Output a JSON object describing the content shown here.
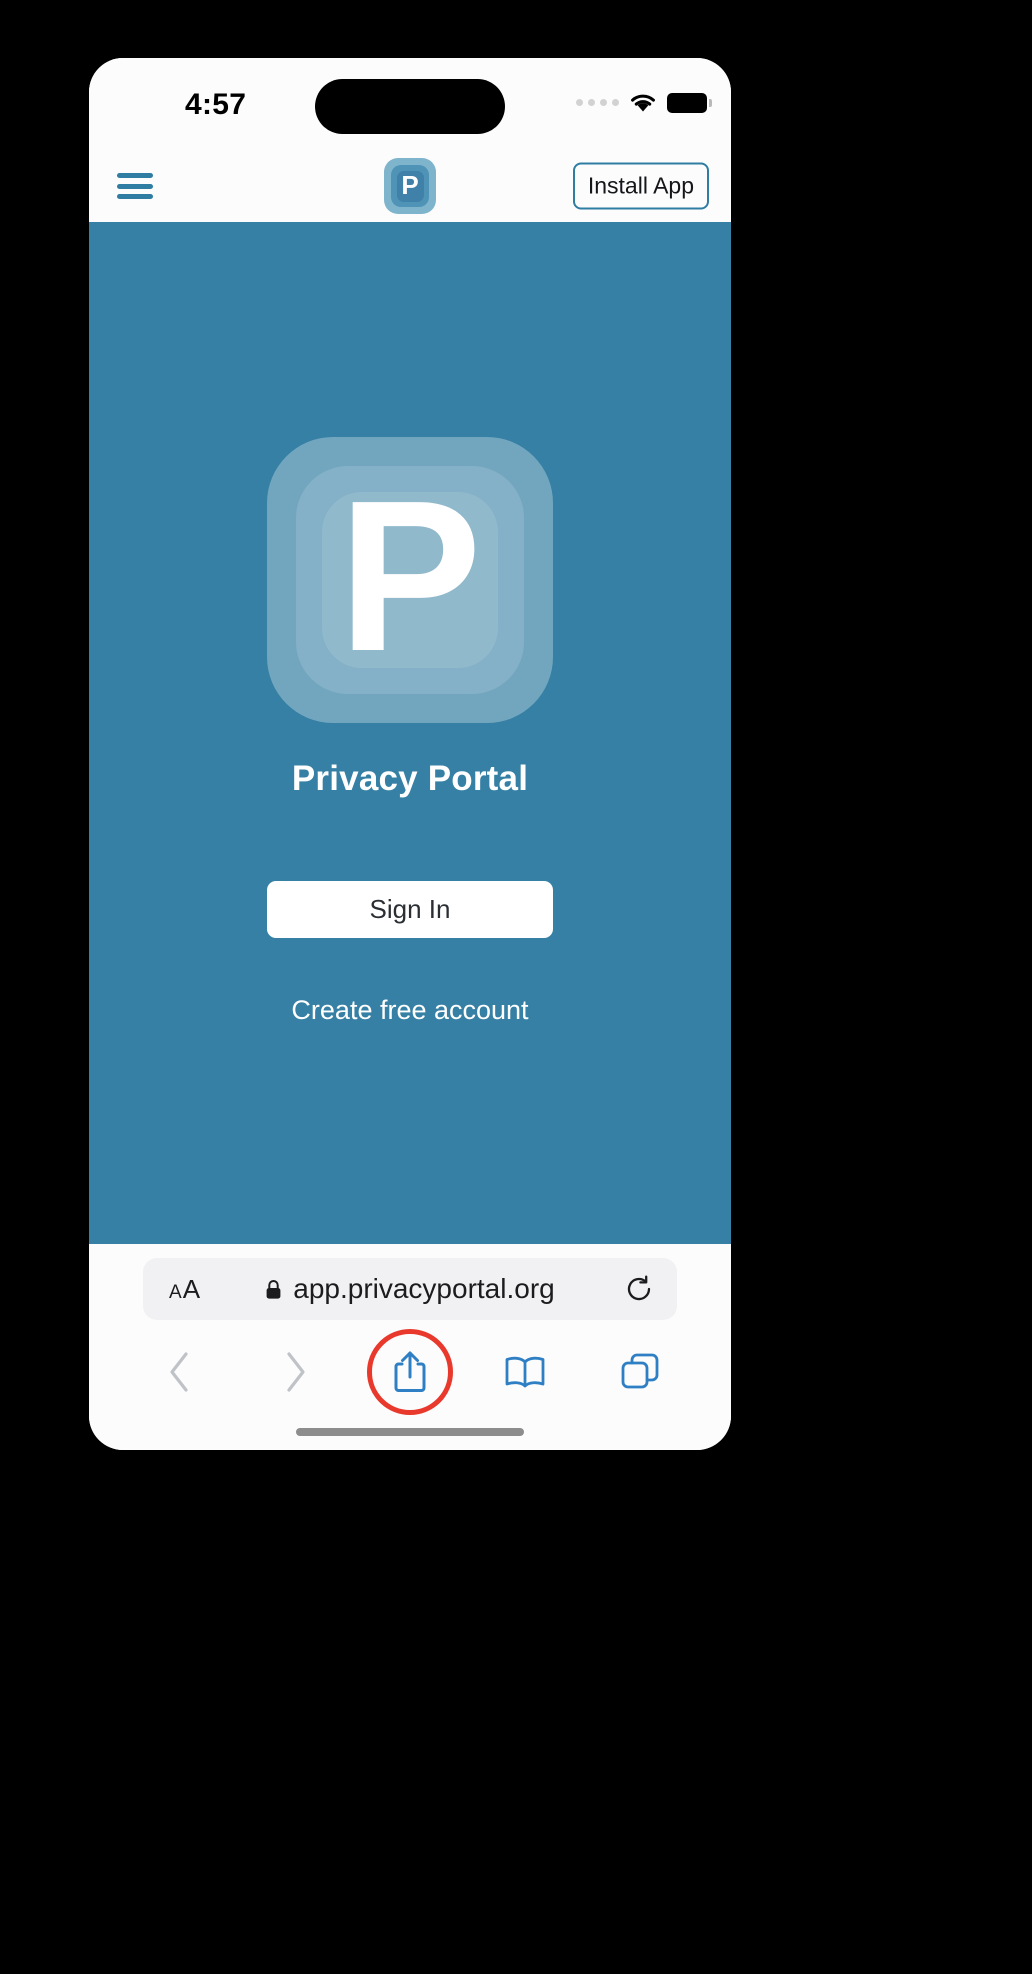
{
  "status_bar": {
    "time": "4:57",
    "signal_icon": "signal-dots-icon",
    "wifi_icon": "wifi-icon",
    "battery_icon": "battery-full-icon"
  },
  "site_header": {
    "menu_icon": "hamburger-menu-icon",
    "logo_letter": "P",
    "logo_icon": "privacy-portal-logo-icon",
    "install_label": "Install App"
  },
  "page": {
    "background_color": "#3580a4",
    "app_icon_letter": "P",
    "app_title": "Privacy Portal",
    "sign_in_label": "Sign In",
    "create_account_label": "Create free account"
  },
  "safari_bar": {
    "text_size_small": "A",
    "text_size_large": "A",
    "text_size_name": "text-size-button",
    "lock_icon": "lock-icon",
    "url": "app.privacyportal.org",
    "reload_icon": "reload-icon",
    "back_icon": "chevron-left-icon",
    "forward_icon": "chevron-right-icon",
    "share_icon": "share-icon",
    "bookmarks_icon": "book-icon",
    "tabs_icon": "tabs-icon",
    "highlight_color": "#e8392c"
  }
}
